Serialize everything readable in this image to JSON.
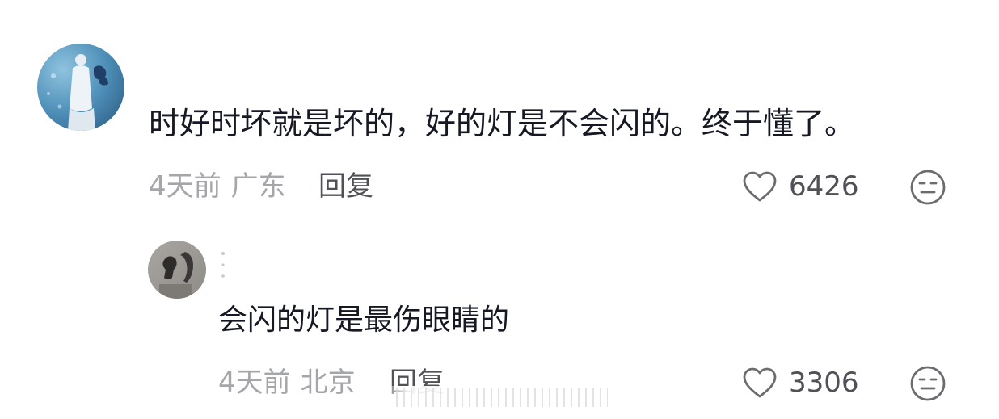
{
  "comment": {
    "text": "时好时坏就是坏的，好的灯是不会闪的。终于懂了。",
    "time": "4天前",
    "location": "广东",
    "reply_label": "回复",
    "like_count": "6426",
    "avatar_icon": "user-avatar-icon",
    "like_icon": "heart-outline-icon",
    "emoji_icon": "neutral-face-icon"
  },
  "reply": {
    "text": "会闪的灯是最伤眼睛的",
    "time": "4天前",
    "location": "北京",
    "reply_label": "回复",
    "like_count": "3306",
    "avatar_icon": "user-avatar-icon",
    "like_icon": "heart-outline-icon",
    "emoji_icon": "neutral-face-icon"
  },
  "colors": {
    "primary_text": "#161823",
    "meta_text": "#a5a6aa",
    "action_text": "#505156"
  }
}
